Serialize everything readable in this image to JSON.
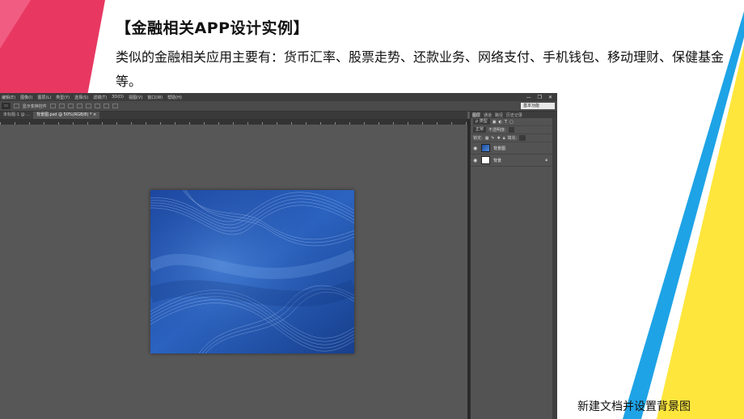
{
  "slide": {
    "title": "【金融相关APP设计实例】",
    "body": "类似的金融相关应用主要有：货币汇率、股票走势、还款业务、网络支付、手机钱包、移动理财、保健基金等。",
    "caption": "新建文档并设置背景图"
  },
  "colors": {
    "accent_pink": "#e83862",
    "accent_blue": "#1ea3e6",
    "accent_yellow": "#ffe63c",
    "ps_bg": "#575757",
    "image_blue": "#2457b0"
  },
  "photoshop": {
    "menu": [
      "编辑(E)",
      "图像(I)",
      "图层(L)",
      "类型(Y)",
      "选择(S)",
      "滤镜(T)",
      "3D(D)",
      "视图(V)",
      "窗口(W)",
      "帮助(H)"
    ],
    "window_controls": [
      "—",
      "❐",
      "✕"
    ],
    "options": {
      "checkbox_label": "显示变换控件",
      "workspace": "基本功能"
    },
    "tabs": [
      {
        "label": "未标题-1 @ ..."
      },
      {
        "label": "背景图.psd @ 50%(RGB/8) * ×",
        "active": true
      }
    ],
    "panel": {
      "tabs": [
        "图层",
        "通道",
        "路径",
        "历史记录"
      ],
      "filter_label": "ρ 类型",
      "blend_mode": "正常",
      "opacity_label": "不透明度:",
      "lock_label": "锁定:",
      "fill_label": "填充:",
      "layers": [
        {
          "name": "背景图",
          "thumb": "blue",
          "visible": true
        },
        {
          "name": "背景",
          "thumb": "white",
          "visible": true,
          "locked": true
        }
      ]
    }
  }
}
